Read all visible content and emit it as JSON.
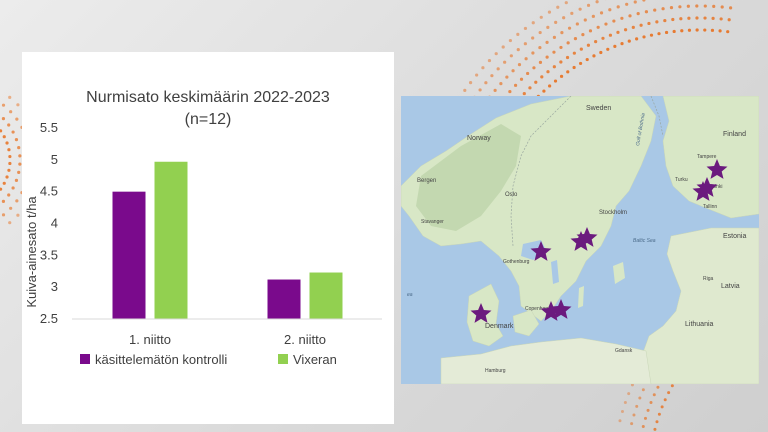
{
  "colors": {
    "series1": "#7a0a8c",
    "series2": "#92d050",
    "accent_dots": "#e8701f",
    "water": "#a9c8e6",
    "land": "#d9e8c8",
    "star": "#6b1a7e"
  },
  "chart_data": {
    "type": "bar",
    "title": "Nurmisato keskimäärin 2022-2023",
    "subtitle": "(n=12)",
    "xlabel": "",
    "ylabel": "Kuiva-ainesato t/ha",
    "categories": [
      "1. niitto",
      "2. niitto"
    ],
    "series": [
      {
        "name": "käsittelemätön kontrolli",
        "values": [
          4.5,
          3.12
        ]
      },
      {
        "name": "Vixeran",
        "values": [
          4.97,
          3.23
        ]
      }
    ],
    "ylim": [
      2.5,
      5.5
    ],
    "yticks": [
      "2.5",
      "3",
      "3.5",
      "4",
      "4.5",
      "5",
      "5.5"
    ],
    "grid": false,
    "legend": "bottom"
  },
  "map": {
    "labels": {
      "sweden": "Sweden",
      "finland": "Finland",
      "norway": "Norway",
      "gulf": "Gulf of Bothnia",
      "bergen": "Bergen",
      "oslo": "Oslo",
      "stavanger": "Stavanger",
      "gothenburg": "Gothenburg",
      "stockholm": "Stockholm",
      "tampere": "Tampere",
      "turku": "Turku",
      "helsinki": "Helsinki",
      "tallinn": "Tallinn",
      "estonia": "Estonia",
      "baltic": "Baltic Sea",
      "riga": "Riga",
      "latvia": "Latvia",
      "denmark": "Denmark",
      "copenhagen": "Copenhagen",
      "lithuania": "Lithuania",
      "gdansk": "Gdansk",
      "hamburg": "Hamburg",
      "sea": "ea"
    }
  }
}
